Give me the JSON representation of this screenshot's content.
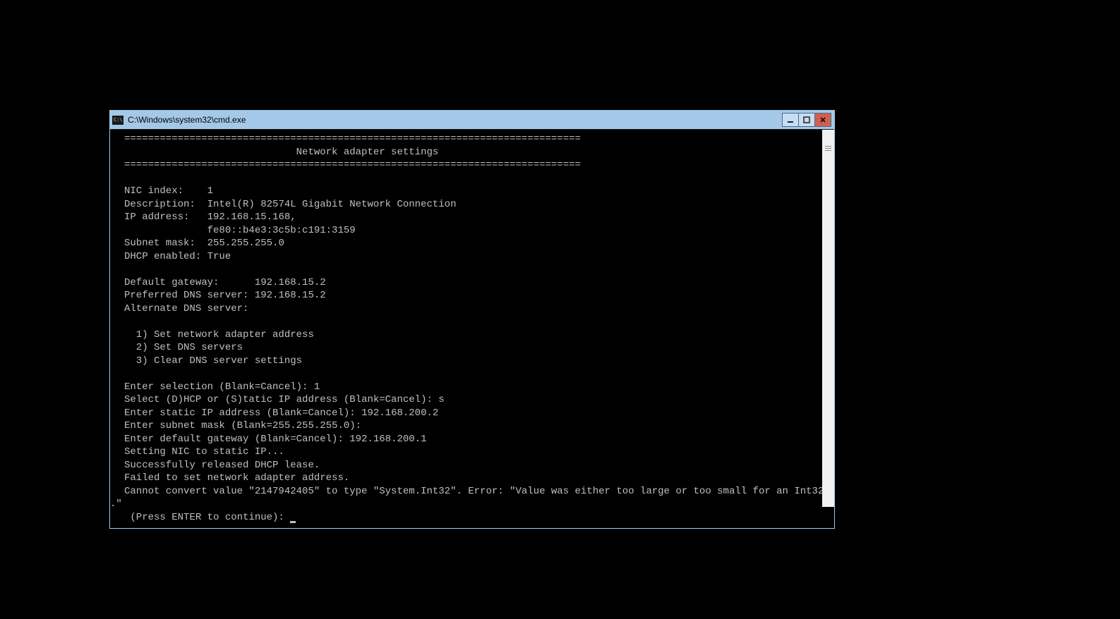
{
  "window": {
    "title": "C:\\Windows\\system32\\cmd.exe"
  },
  "console": {
    "divider": "=============================================================================",
    "header_title": "                             Network adapter settings",
    "nic_index_label": "NIC index:    ",
    "nic_index_value": "1",
    "description_label": "Description:  ",
    "description_value": "Intel(R) 82574L Gigabit Network Connection",
    "ip_address_label": "IP address:   ",
    "ip_address_value1": "192.168.15.168,",
    "ip_address_value2": "              fe80::b4e3:3c5b:c191:3159",
    "subnet_mask_label": "Subnet mask:  ",
    "subnet_mask_value": "255.255.255.0",
    "dhcp_enabled_label": "DHCP enabled: ",
    "dhcp_enabled_value": "True",
    "default_gateway_label": "Default gateway:      ",
    "default_gateway_value": "192.168.15.2",
    "preferred_dns_label": "Preferred DNS server: ",
    "preferred_dns_value": "192.168.15.2",
    "alternate_dns_label": "Alternate DNS server:",
    "option1": "  1) Set network adapter address",
    "option2": "  2) Set DNS servers",
    "option3": "  3) Clear DNS server settings",
    "prompt_selection": "Enter selection (Blank=Cancel): ",
    "input_selection": "1",
    "prompt_dhcp": "Select (D)HCP or (S)tatic IP address (Blank=Cancel): ",
    "input_dhcp": "s",
    "prompt_static_ip": "Enter static IP address (Blank=Cancel): ",
    "input_static_ip": "192.168.200.2",
    "prompt_subnet": "Enter subnet mask (Blank=255.255.255.0):",
    "prompt_gateway": "Enter default gateway (Blank=Cancel): ",
    "input_gateway": "192.168.200.1",
    "setting_msg": "Setting NIC to static IP...",
    "released_msg": "Successfully released DHCP lease.",
    "failed_msg": "Failed to set network adapter address.",
    "error_msg": "Cannot convert value \"2147942405\" to type \"System.Int32\". Error: \"Value was either too large or too small for an Int32",
    "error_msg_cont": ".\"",
    "press_enter": " (Press ENTER to continue): "
  }
}
